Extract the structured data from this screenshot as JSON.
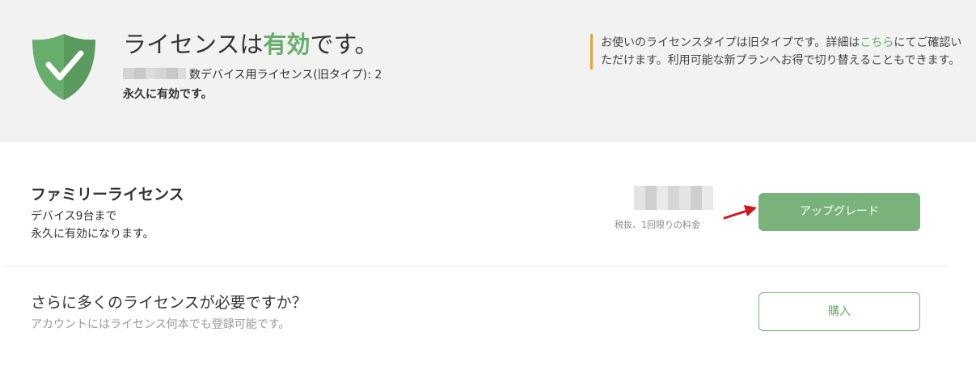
{
  "status": {
    "title_prefix": "ライセンスは",
    "title_highlight": "有効",
    "title_suffix": "です。",
    "key_line": "数デバイス用ライセンス(旧タイプ): 2",
    "permanent": "永久に有効です。",
    "accent_color": "#67ad6b"
  },
  "notice": {
    "text_before": "お使いのライセンスタイプは旧タイプです。詳細は",
    "link_text": "こちら",
    "text_after": "にてご確認いただけます。利用可能な新プランへお得で切り替えることもできます。",
    "border_color": "#e8a03a"
  },
  "offer": {
    "title": "ファミリーライセンス",
    "line1": "デバイス9台まで",
    "line2": "永久に有効になります。",
    "price_note": "税抜、1回限りの料金",
    "upgrade_label": "アップグレード"
  },
  "more": {
    "title": "さらに多くのライセンスが必要ですか？",
    "subtitle": "アカウントにはライセンス何本でも登録可能です。",
    "buy_label": "購入"
  },
  "icons": {
    "shield": "shield-check-icon",
    "arrow": "red-arrow-icon"
  }
}
